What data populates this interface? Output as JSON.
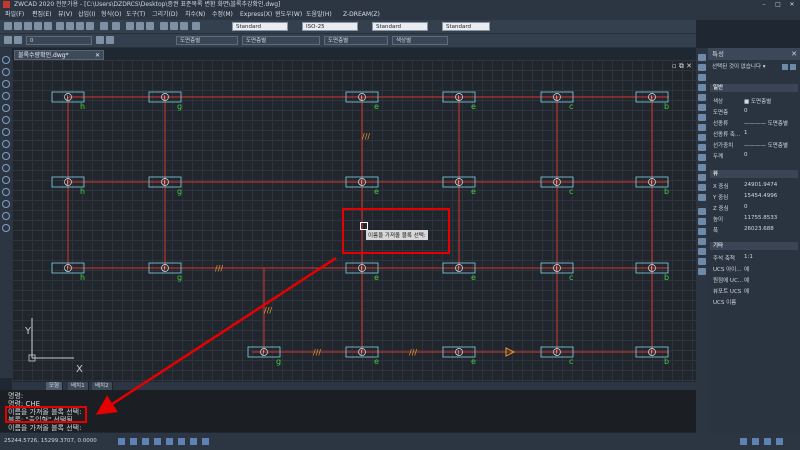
{
  "window": {
    "title": "ZWCAD 2020 전문가용 - [C:\\Users\\DZDRCS\\Desktop\\증권 표준목록 변환 화면\\블록추강확인.dwg]",
    "min": "–",
    "max": "□",
    "close": "✕"
  },
  "menu": [
    "파일(F)",
    "편집(E)",
    "뷰(V)",
    "삽입(I)",
    "형식(O)",
    "도구(T)",
    "그리기(D)",
    "치수(N)",
    "수정(M)",
    "Express(X)",
    "윈도우(W)",
    "도움말(H)",
    "Z-DREAM(Z)"
  ],
  "toolbar": {
    "text_style": "Standard",
    "dim_style": "ISO-25",
    "table_style": "Standard",
    "multileader_style": "Standard",
    "layer": "0",
    "color": "도면층별",
    "linetype": "도면층별",
    "lineweight": "도면층별",
    "plotstyle": "색상별"
  },
  "document_tab": {
    "label": "블록수량확인.dwg*",
    "close": "✕"
  },
  "view_controls": "▫ ⧉ ✕",
  "drawing": {
    "grid_labels": {
      "h": "h",
      "g": "g",
      "e": "e",
      "c": "c",
      "b": "b"
    },
    "node_symbol": "J",
    "hover_tooltip": "이름을 가져올 블록 선택:",
    "axis_x": "X",
    "axis_y": "Y",
    "highlight_color": "#e60000",
    "line_color": "#d9342b",
    "node_border_color": "#7fd3e6",
    "label_color": "#3dd13d"
  },
  "layout_tabs": [
    "모형",
    "배치1",
    "배치2"
  ],
  "command_history": [
    "명령:",
    "명령: CHE",
    "이름을 가져올 블록 선택:",
    "블록: \"출입형\" 선택됨"
  ],
  "command_prompt": "이름을 가져올 블록 선택:",
  "status": {
    "coords": "25244.5726, 15299.3707, 0.0000"
  },
  "properties": {
    "title": "특성",
    "selection": "선택된 것이 없습니다",
    "sections": [
      {
        "name": "일반",
        "rows": [
          {
            "label": "색상",
            "value": "■ 도면층별"
          },
          {
            "label": "도면층",
            "value": "0"
          },
          {
            "label": "선종류",
            "value": "———— 도면층별"
          },
          {
            "label": "선종류 축...",
            "value": "1"
          },
          {
            "label": "선가중치",
            "value": "———— 도면층별"
          },
          {
            "label": "두께",
            "value": "0"
          }
        ]
      },
      {
        "name": "뷰",
        "rows": [
          {
            "label": "X 중심",
            "value": "24901.9474"
          },
          {
            "label": "Y 중심",
            "value": "15454.4996"
          },
          {
            "label": "Z 중심",
            "value": "0"
          },
          {
            "label": "높이",
            "value": "11755.8533"
          },
          {
            "label": "폭",
            "value": "26023.688"
          }
        ]
      },
      {
        "name": "기타",
        "rows": [
          {
            "label": "주석 축척",
            "value": "1:1"
          },
          {
            "label": "UCS 아이...",
            "value": "예"
          },
          {
            "label": "원점에 UC...",
            "value": "예"
          },
          {
            "label": "뷰포트 UCS",
            "value": "예"
          },
          {
            "label": "UCS 이름",
            "value": ""
          }
        ]
      }
    ]
  }
}
